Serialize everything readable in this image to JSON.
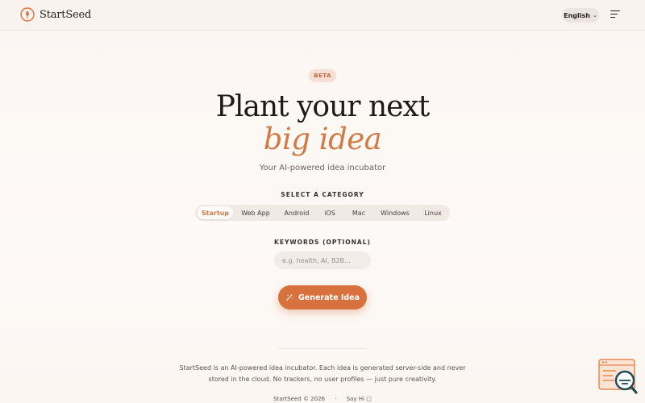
{
  "header": {
    "brand": "StartSeed",
    "language": "English"
  },
  "hero": {
    "badge": "BETA",
    "title_line1": "Plant your next",
    "title_line2": "big idea",
    "tagline": "Your AI-powered idea incubator"
  },
  "category": {
    "label": "SELECT A CATEGORY",
    "options": [
      "Startup",
      "Web App",
      "Android",
      "iOS",
      "Mac",
      "Windows",
      "Linux"
    ],
    "selected": "Startup"
  },
  "keywords": {
    "label": "KEYWORDS (OPTIONAL)",
    "placeholder": "e.g. health, AI, B2B...",
    "value": ""
  },
  "generate_button": "Generate Idea",
  "about": "StartSeed is an AI-powered idea incubator. Each idea is generated server-side and never stored in the cloud. No trackers, no user profiles — just pure creativity.",
  "footer": {
    "copyright": "StartSeed © 2026",
    "separator": "·",
    "say_hi": "Say Hi □"
  },
  "colors": {
    "accent": "#d7723e",
    "accent_text": "#d27a45",
    "badge_bg": "#f6dfd3"
  },
  "icons": {
    "logo": "seed-logo-icon",
    "menu": "hamburger-menu-icon",
    "generate": "magic-wand-icon",
    "widget": "chat-search-widget-icon"
  }
}
